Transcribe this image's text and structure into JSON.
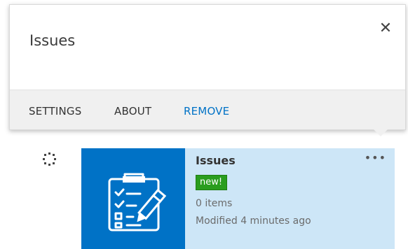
{
  "callout": {
    "title": "Issues",
    "close_icon": "close-icon",
    "actions": [
      {
        "label": "SETTINGS"
      },
      {
        "label": "ABOUT"
      },
      {
        "label": "REMOVE",
        "color": "#0072c6"
      }
    ]
  },
  "tile": {
    "name": "Issues",
    "badge": "new!",
    "item_count": "0 items",
    "modified": "Modified 4 minutes ago",
    "more_label": "•••",
    "icon": "clipboard-checklist-pencil-icon",
    "icon_bg_color": "#0072c6",
    "tile_bg_color": "#cde6f7",
    "badge_color": "#2a9d1e"
  }
}
